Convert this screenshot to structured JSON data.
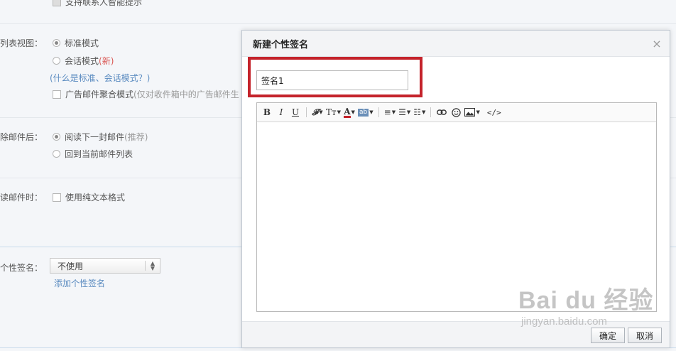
{
  "settings": {
    "top_option": "支持联系人智能提示",
    "list_view": {
      "label": "列表视图：",
      "standard": "标准模式",
      "conversation": "会话模式",
      "new_badge": "(新)",
      "help_link": "(什么是标准、会话模式？)",
      "ad_aggregate": "广告邮件聚合模式",
      "ad_aggregate_note": "(仅对收件箱中的广告邮件生"
    },
    "after_delete": {
      "label": "除邮件后：",
      "read_next": "阅读下一封邮件",
      "recommended": "(推荐)",
      "back_to_list": "回到当前邮件列表"
    },
    "reading": {
      "label": "读邮件时：",
      "plain_text": "使用纯文本格式"
    },
    "signature": {
      "label": "个性签名：",
      "selected": "不使用",
      "add_link": "添加个性签名"
    }
  },
  "dialog": {
    "title": "新建个性签名",
    "close_glyph": "×",
    "name_value": "签名1",
    "toolbar": {
      "bold": "B",
      "italic": "I",
      "underline": "U",
      "font_family": "𝓕",
      "font_size": "Tт",
      "font_color": "A",
      "bg_color": "ab",
      "align": "≡",
      "unordered_list": "☰",
      "ordered_list": "☷",
      "link": "🔗",
      "emoji": "☺",
      "image": "▨",
      "source": "</>"
    },
    "ok_label": "确定",
    "cancel_label": "取消"
  },
  "watermark": {
    "logo": "Bai du 经验",
    "url": "jingyan.baidu.com"
  },
  "colors": {
    "highlight": "#c4232b",
    "link": "#5a8bc0",
    "new_badge": "#d9534f"
  }
}
